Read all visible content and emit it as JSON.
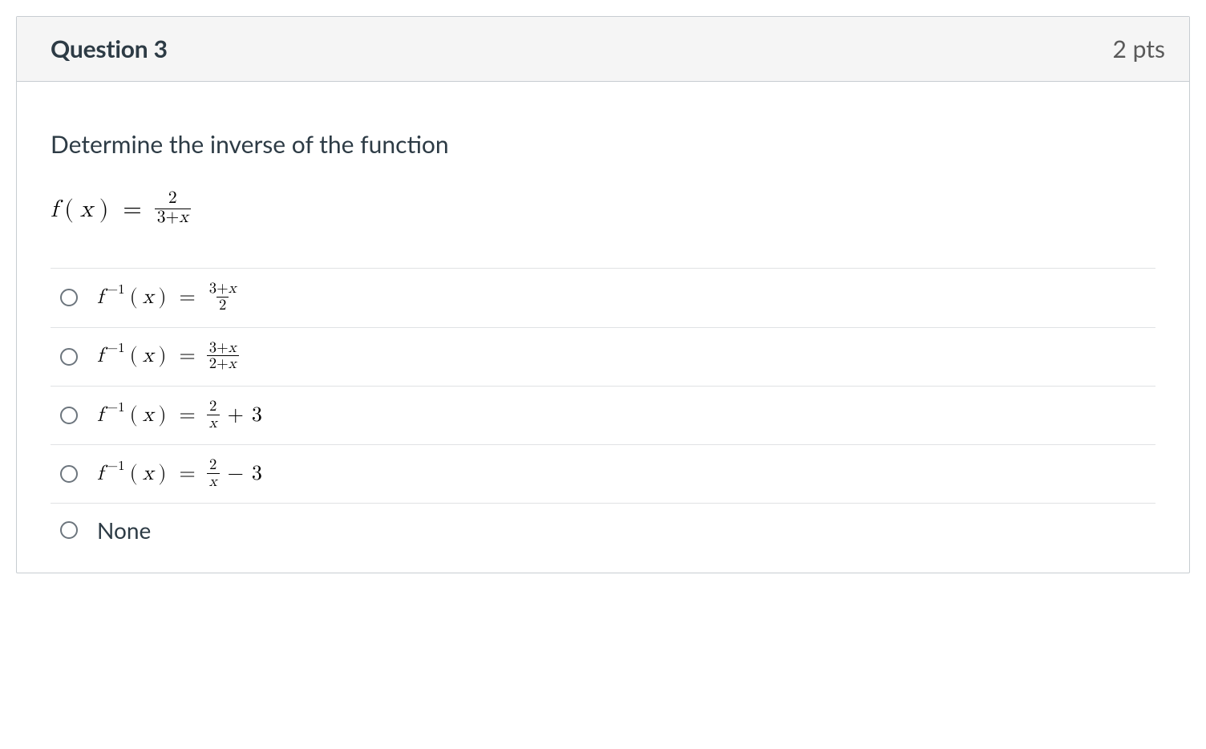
{
  "header": {
    "title": "Question 3",
    "points": "2 pts"
  },
  "prompt": "Determine the inverse of the function",
  "function": {
    "lhs_f": "f",
    "lhs_open": "(",
    "lhs_var": "x",
    "lhs_close": ")",
    "eq": "=",
    "frac_num": "2",
    "frac_den_a": "3",
    "frac_den_op": "+",
    "frac_den_b": "x"
  },
  "answers": [
    {
      "type": "math",
      "lhs_f": "f",
      "lhs_sup": "−1",
      "lhs_open": "(",
      "lhs_var": "x",
      "lhs_close": ")",
      "eq": "=",
      "frac_num_a": "3",
      "frac_num_op": "+",
      "frac_num_b": "x",
      "frac_den": "2",
      "tail_op": "",
      "tail_num": ""
    },
    {
      "type": "math",
      "lhs_f": "f",
      "lhs_sup": "−1",
      "lhs_open": "(",
      "lhs_var": "x",
      "lhs_close": ")",
      "eq": "=",
      "frac_num_a": "3",
      "frac_num_op": "+",
      "frac_num_b": "x",
      "frac_den_a": "2",
      "frac_den_op": "+",
      "frac_den_b": "x",
      "tail_op": "",
      "tail_num": ""
    },
    {
      "type": "math",
      "lhs_f": "f",
      "lhs_sup": "−1",
      "lhs_open": "(",
      "lhs_var": "x",
      "lhs_close": ")",
      "eq": "=",
      "frac_num": "2",
      "frac_den_var": "x",
      "tail_op": "+",
      "tail_num": "3"
    },
    {
      "type": "math",
      "lhs_f": "f",
      "lhs_sup": "−1",
      "lhs_open": "(",
      "lhs_var": "x",
      "lhs_close": ")",
      "eq": "=",
      "frac_num": "2",
      "frac_den_var": "x",
      "tail_op": "−",
      "tail_num": "3"
    },
    {
      "type": "text",
      "text": "None"
    }
  ]
}
